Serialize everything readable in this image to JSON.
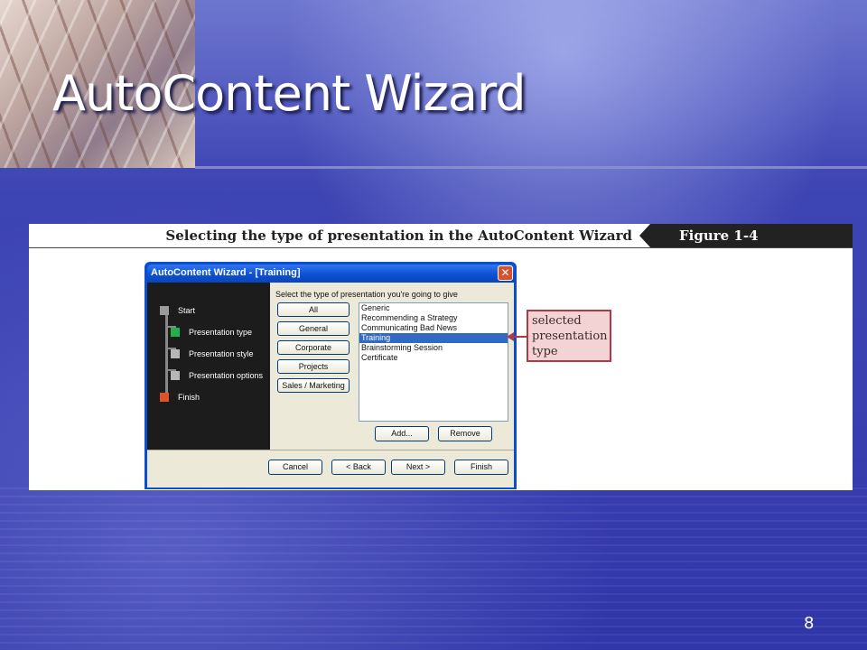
{
  "slide": {
    "title": "AutoContent Wizard",
    "page_number": "8"
  },
  "figure": {
    "caption": "Selecting the type of presentation in the AutoContent Wizard",
    "label": "Figure 1-4"
  },
  "dialog": {
    "title": "AutoContent Wizard - [Training]",
    "close_glyph": "✕",
    "steps": [
      {
        "label": "Start",
        "color": "#9a9a9a"
      },
      {
        "label": "Presentation type",
        "color": "#1fb24a"
      },
      {
        "label": "Presentation style",
        "color": "#b7b7b7"
      },
      {
        "label": "Presentation options",
        "color": "#b7b7b7"
      },
      {
        "label": "Finish",
        "color": "#e0532a"
      }
    ],
    "prompt": "Select the type of presentation you're going to give",
    "categories": [
      "All",
      "General",
      "Corporate",
      "Projects",
      "Sales / Marketing"
    ],
    "presentation_types": [
      "Generic",
      "Recommending a Strategy",
      "Communicating Bad News",
      "Training",
      "Brainstorming Session",
      "Certificate"
    ],
    "selected_type": "Training",
    "add_label": "Add...",
    "remove_label": "Remove",
    "footer_buttons": {
      "cancel": "Cancel",
      "back": "< Back",
      "next": "Next >",
      "finish": "Finish"
    }
  },
  "callout": {
    "lines": [
      "selected",
      "presentation",
      "type"
    ],
    "color": "#b03a44"
  }
}
